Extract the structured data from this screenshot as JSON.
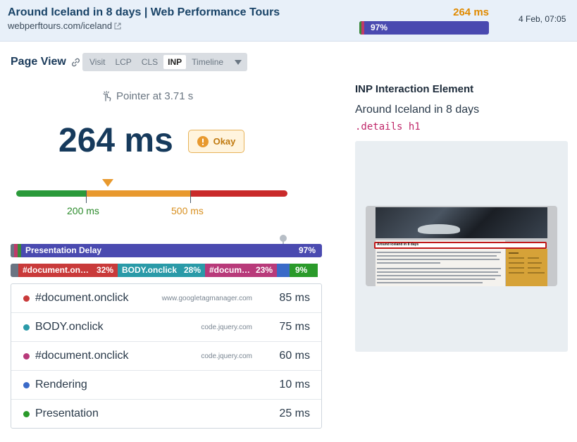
{
  "header": {
    "title": "Around Iceland in 8 days | Web Performance Tours",
    "url": "webperftours.com/iceland",
    "value": "264 ms",
    "bar_percent_label": "97%",
    "date": "4 Feb, 07:05"
  },
  "page_view": {
    "title": "Page View",
    "tabs": [
      "Visit",
      "LCP",
      "CLS",
      "INP",
      "Timeline"
    ],
    "active_tab": "INP"
  },
  "metric": {
    "interaction": "Pointer at 3.71 s",
    "value": "264 ms",
    "rating": "Okay",
    "threshold_good": "200 ms",
    "threshold_poor": "500 ms"
  },
  "colors": {
    "good": "#2a9a3a",
    "needs_improvement": "#e8992e",
    "poor": "#c92a2a",
    "presentation_delay": "#4a4ab0"
  },
  "breakdown": {
    "presentation_delay_label": "Presentation Delay",
    "presentation_delay_pct": "97%",
    "segments": [
      {
        "label": "",
        "color": "#6a7482",
        "fraction": 0.025
      },
      {
        "label": "#document.on…",
        "pct": "32%",
        "color": "#c93a3a",
        "fraction": 0.32
      },
      {
        "label": "BODY.onclick",
        "pct": "28%",
        "color": "#2a9aa8",
        "fraction": 0.28
      },
      {
        "label": "#docum…",
        "pct": "23%",
        "color": "#b83a7a",
        "fraction": 0.23
      },
      {
        "label": "",
        "color": "#3a6ac8",
        "fraction": 0.04
      },
      {
        "label": "",
        "pct": "9%",
        "color": "#2a9a2a",
        "fraction": 0.09
      }
    ]
  },
  "scripts": [
    {
      "name": "#document.onclick",
      "source": "www.googletagmanager.com",
      "duration": "85 ms",
      "color": "#c93a3a"
    },
    {
      "name": "BODY.onclick",
      "source": "code.jquery.com",
      "duration": "75 ms",
      "color": "#2a9aa8"
    },
    {
      "name": "#document.onclick",
      "source": "code.jquery.com",
      "duration": "60 ms",
      "color": "#b83a7a"
    },
    {
      "name": "Rendering",
      "source": "",
      "duration": "10 ms",
      "color": "#3a6ac8"
    },
    {
      "name": "Presentation",
      "source": "",
      "duration": "25 ms",
      "color": "#2a9a2a"
    }
  ],
  "element_panel": {
    "heading": "INP Interaction Element",
    "element_text": "Around Iceland in 8 days",
    "selector": ".details h1",
    "preview_heading": "Around Iceland in 8 days"
  }
}
